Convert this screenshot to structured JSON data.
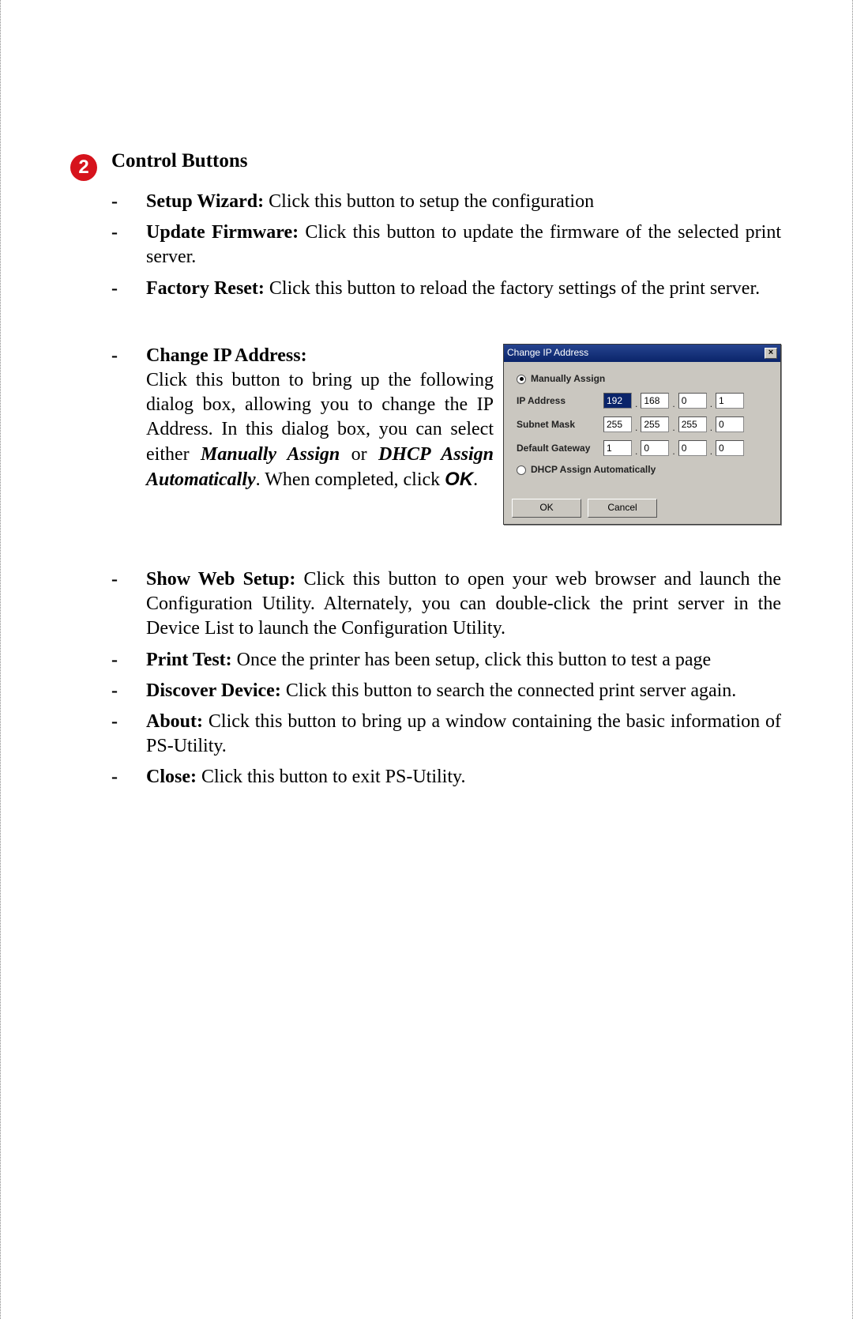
{
  "badge": "2",
  "section_title": "Control Buttons",
  "items_top": [
    {
      "label": "Setup Wizard:",
      "text": " Click this button to setup the configuration"
    },
    {
      "label": "Update Firmware:",
      "text": " Click this button to update the firmware of the selected print server."
    },
    {
      "label": "Factory Reset:",
      "text": " Click this button to reload the factory settings of the print server."
    }
  ],
  "change_ip": {
    "label": "Change IP Address:",
    "text1": "Click this button to bring up the following dialog box, allowing you to change the IP Address. In this dialog box, you can select either ",
    "em1": "Manually Assign",
    "text2": " or ",
    "em2": "DHCP Assign Automatically",
    "text3": ".   When completed, click ",
    "ok": "OK",
    "text4": "."
  },
  "dialog": {
    "title": "Change IP Address",
    "close": "×",
    "radio_manual": "Manually Assign",
    "radio_dhcp": "DHCP Assign Automatically",
    "lbl_ip": "IP Address",
    "lbl_mask": "Subnet Mask",
    "lbl_gw": "Default Gateway",
    "ip": [
      "192",
      "168",
      "0",
      "1"
    ],
    "mask": [
      "255",
      "255",
      "255",
      "0"
    ],
    "gw": [
      "1",
      "0",
      "0",
      "0"
    ],
    "btn_ok": "OK",
    "btn_cancel": "Cancel"
  },
  "items_bottom": [
    {
      "label": "Show Web Setup:",
      "text": " Click this button to open your web browser and launch the Configuration Utility.  Alternately, you can double-click the print server in the Device List to launch the Configuration Utility."
    },
    {
      "label": "Print Test:",
      "text": " Once the printer has been setup, click this button to test a page"
    },
    {
      "label": "Discover Device:",
      "text": " Click this button to search the connected print server again."
    },
    {
      "label": "About:",
      "text": " Click this button to bring up a window containing the basic information of PS-Utility."
    },
    {
      "label": "Close:",
      "text": " Click this button to exit PS-Utility."
    }
  ]
}
